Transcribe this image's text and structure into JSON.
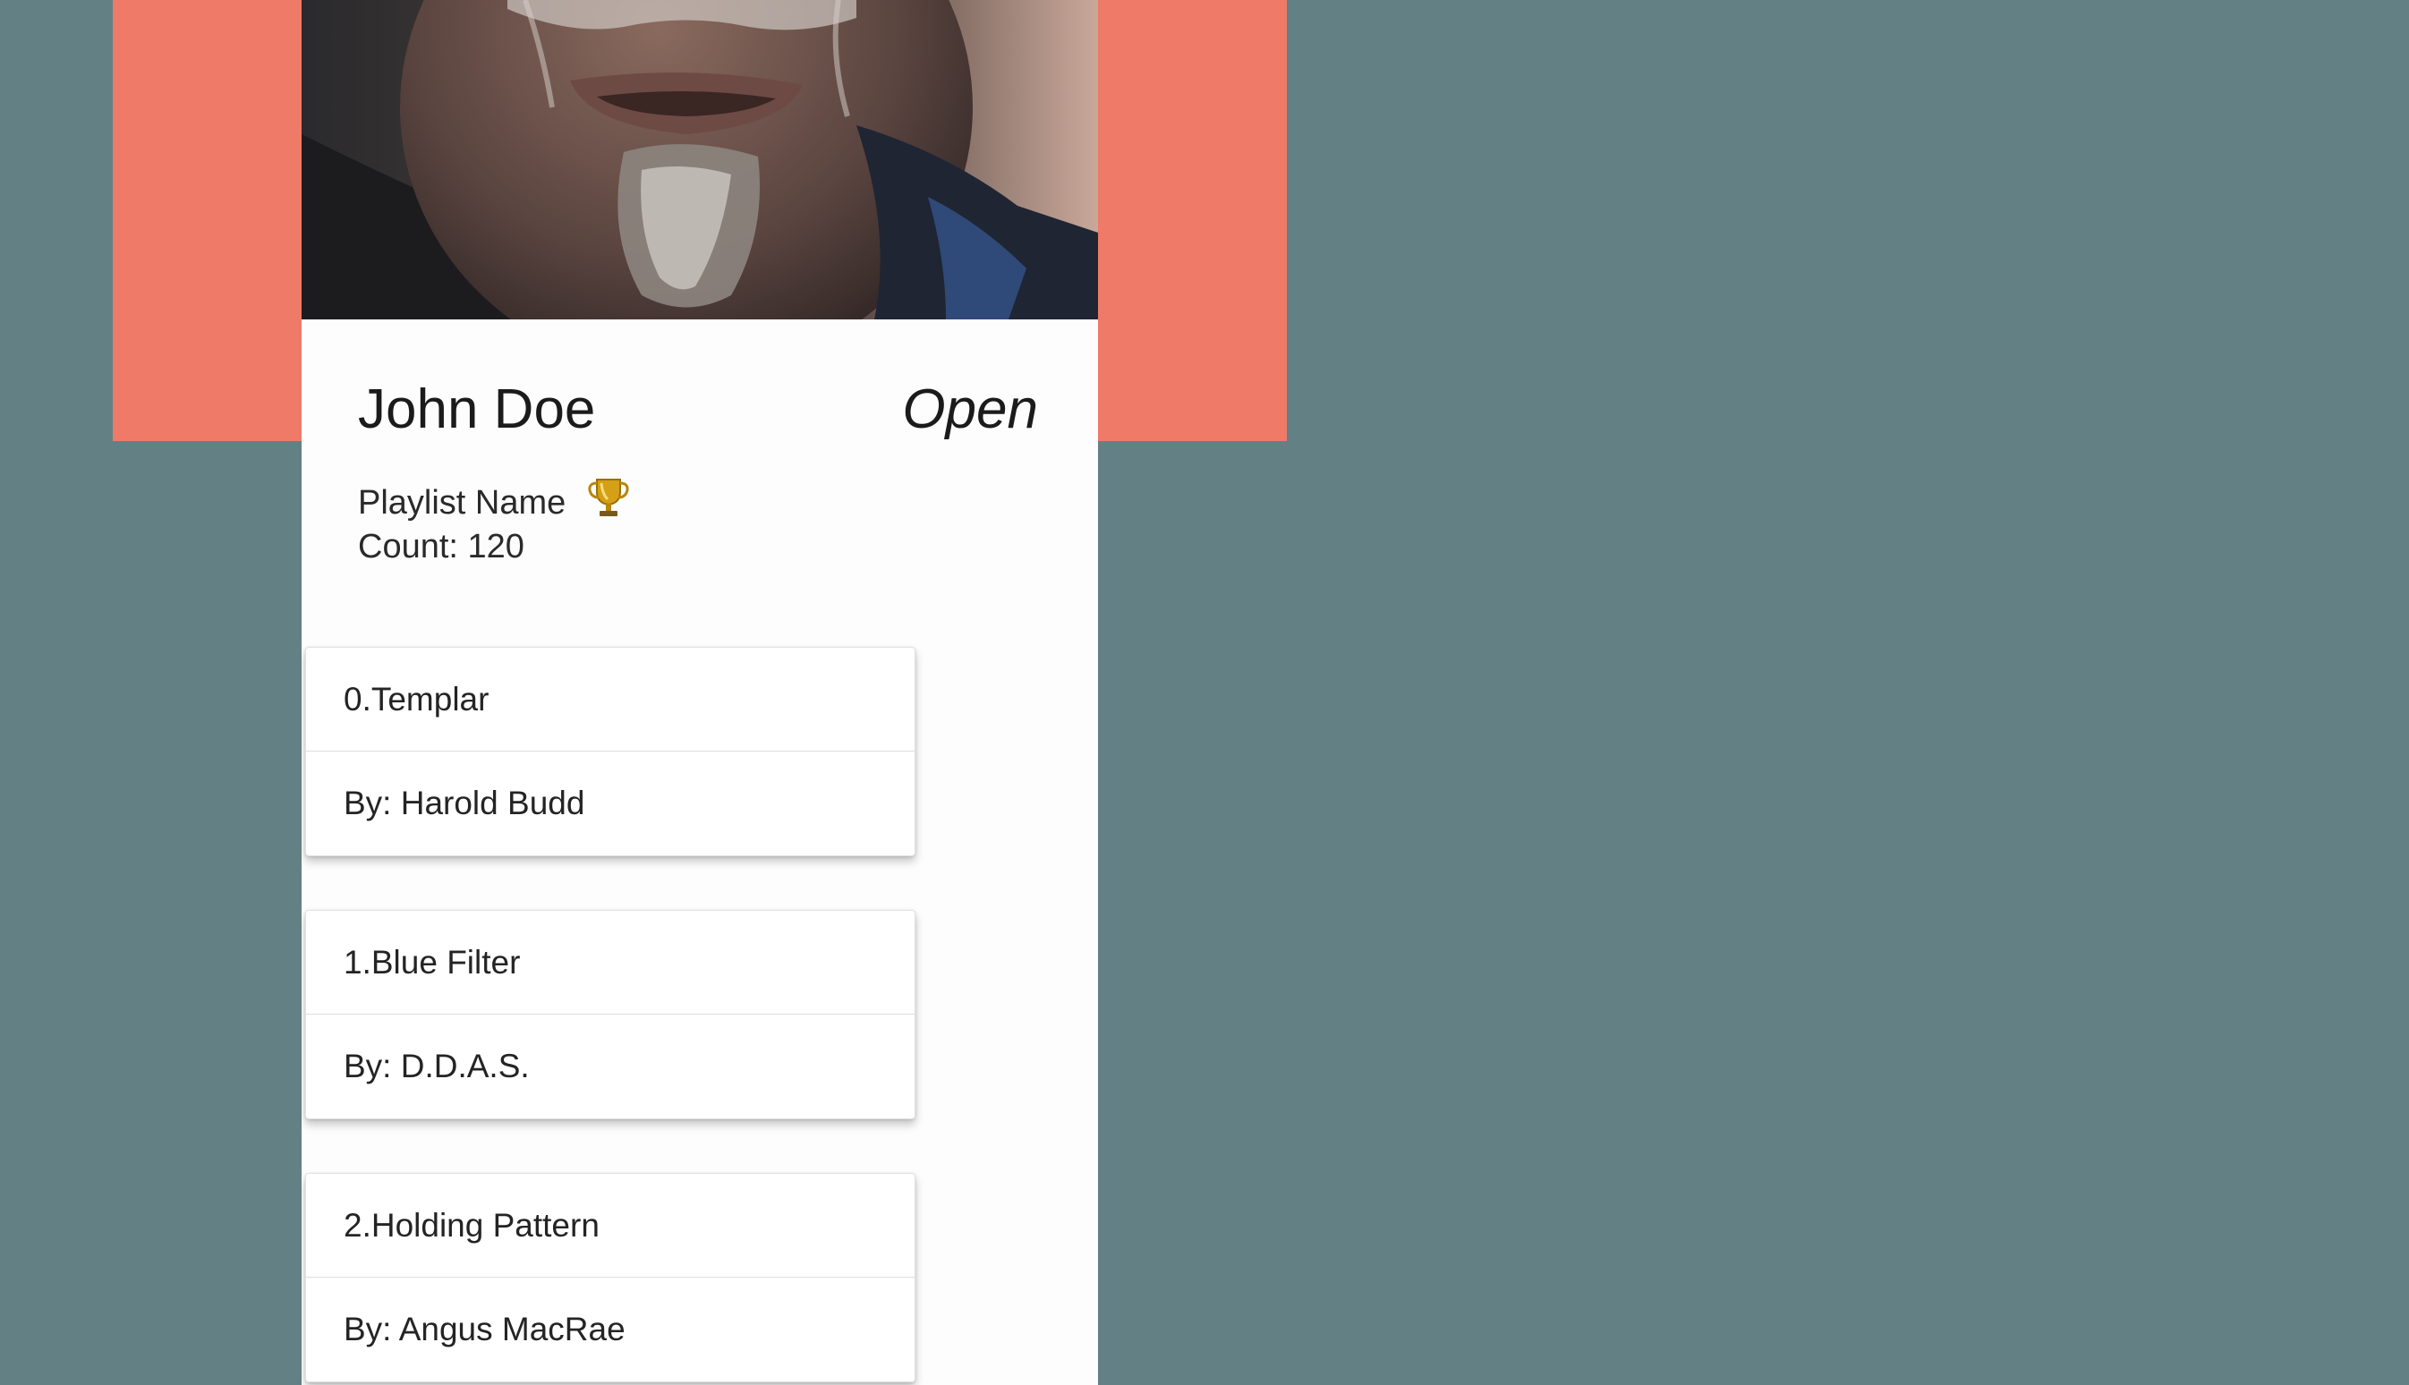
{
  "colors": {
    "page_background": "#638085",
    "header_band": "#ef7a68",
    "card_background": "#fdfdfd"
  },
  "profile": {
    "name": "John Doe",
    "status": "Open",
    "playlist_name": "Playlist Name",
    "playlist_icon": "trophy-icon",
    "count_label": "Count: 120"
  },
  "tracks": [
    {
      "title": "0.Templar",
      "artist": "By: Harold Budd"
    },
    {
      "title": "1.Blue Filter",
      "artist": "By: D.D.A.S."
    },
    {
      "title": "2.Holding Pattern",
      "artist": "By: Angus MacRae"
    }
  ]
}
